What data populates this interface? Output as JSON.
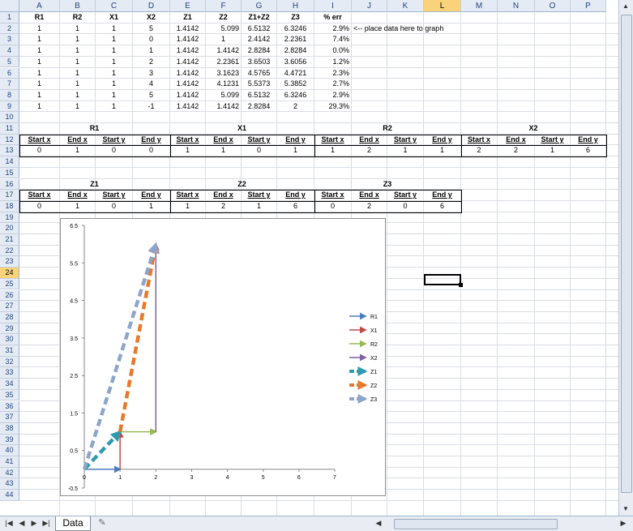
{
  "columns": [
    "A",
    "B",
    "C",
    "D",
    "E",
    "F",
    "G",
    "H",
    "I",
    "J",
    "K",
    "L",
    "M",
    "N",
    "O",
    "P"
  ],
  "selected_column": "L",
  "selected_row": "24",
  "rows": [
    "1",
    "2",
    "3",
    "4",
    "5",
    "6",
    "7",
    "8",
    "9",
    "10",
    "11",
    "12",
    "13",
    "14",
    "15",
    "16",
    "17",
    "18",
    "19",
    "20",
    "21",
    "22",
    "23",
    "24",
    "25",
    "26",
    "27",
    "28",
    "29",
    "30",
    "31",
    "32",
    "33",
    "34",
    "35",
    "36",
    "37",
    "38",
    "39",
    "40",
    "41",
    "42",
    "43",
    "44"
  ],
  "table": {
    "headers": [
      "R1",
      "R2",
      "X1",
      "X2",
      "Z1",
      "Z2",
      "Z1+Z2",
      "Z3",
      "% err"
    ],
    "rows": [
      [
        "1",
        "1",
        "1",
        "5",
        "1.4142",
        "5.099",
        "6.5132",
        "6.3246",
        "2.9%"
      ],
      [
        "1",
        "1",
        "1",
        "0",
        "1.4142",
        "1",
        "2.4142",
        "2.2361",
        "7.4%"
      ],
      [
        "1",
        "1",
        "1",
        "1",
        "1.4142",
        "1.4142",
        "2.8284",
        "2.8284",
        "0.0%"
      ],
      [
        "1",
        "1",
        "1",
        "2",
        "1.4142",
        "2.2361",
        "3.6503",
        "3.6056",
        "1.2%"
      ],
      [
        "1",
        "1",
        "1",
        "3",
        "1.4142",
        "3.1623",
        "4.5765",
        "4.4721",
        "2.3%"
      ],
      [
        "1",
        "1",
        "1",
        "4",
        "1.4142",
        "4.1231",
        "5.5373",
        "5.3852",
        "2.7%"
      ],
      [
        "1",
        "1",
        "1",
        "5",
        "1.4142",
        "5.099",
        "6.5132",
        "6.3246",
        "2.9%"
      ],
      [
        "1",
        "1",
        "1",
        "-1",
        "1.4142",
        "1.4142",
        "2.8284",
        "2",
        "29.3%"
      ]
    ],
    "note": "<-- place data here to graph"
  },
  "vectors_top": {
    "groups": [
      "R1",
      "X1",
      "R2",
      "X2"
    ],
    "subheaders": [
      "Start x",
      "End x",
      "Start y",
      "End y"
    ],
    "values": [
      "0",
      "1",
      "0",
      "0",
      "1",
      "1",
      "0",
      "1",
      "1",
      "2",
      "1",
      "1",
      "2",
      "2",
      "1",
      "6"
    ]
  },
  "vectors_bottom": {
    "groups": [
      "Z1",
      "Z2",
      "Z3"
    ],
    "subheaders": [
      "Start x",
      "End x",
      "Start y",
      "End y"
    ],
    "values": [
      "0",
      "1",
      "0",
      "1",
      "1",
      "2",
      "1",
      "6",
      "0",
      "2",
      "0",
      "6"
    ]
  },
  "chart_data": {
    "type": "scatter",
    "xlim": [
      0,
      7
    ],
    "ylim": [
      -0.5,
      6.5
    ],
    "x_ticks": [
      "0",
      "1",
      "2",
      "3",
      "4",
      "5",
      "6",
      "7"
    ],
    "y_ticks": [
      "6.5",
      "5.5",
      "4.5",
      "3.5",
      "2.5",
      "1.5",
      "0.5",
      "-0.5"
    ],
    "legend_position": "right",
    "series": [
      {
        "name": "R1",
        "x": [
          0,
          1
        ],
        "y": [
          0,
          0
        ],
        "color": "#4a7ebb",
        "style": "solid"
      },
      {
        "name": "X1",
        "x": [
          1,
          1
        ],
        "y": [
          0,
          1
        ],
        "color": "#be4b48",
        "style": "solid"
      },
      {
        "name": "R2",
        "x": [
          1,
          2
        ],
        "y": [
          1,
          1
        ],
        "color": "#98b954",
        "style": "solid"
      },
      {
        "name": "X2",
        "x": [
          2,
          2
        ],
        "y": [
          1,
          6
        ],
        "color": "#7d60a0",
        "style": "solid"
      },
      {
        "name": "Z1",
        "x": [
          0,
          1
        ],
        "y": [
          0,
          1
        ],
        "color": "#2c9bb0",
        "style": "dashed"
      },
      {
        "name": "Z2",
        "x": [
          1,
          2
        ],
        "y": [
          1,
          6
        ],
        "color": "#e8792b",
        "style": "dashed"
      },
      {
        "name": "Z3",
        "x": [
          0,
          2
        ],
        "y": [
          0,
          6
        ],
        "color": "#8ea5cb",
        "style": "dashed"
      }
    ]
  },
  "tabs": {
    "active": "Data",
    "new_tab_icon": "insert-sheet-icon"
  }
}
